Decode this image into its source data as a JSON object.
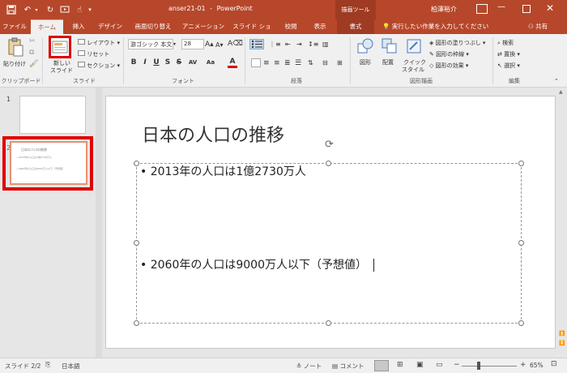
{
  "titlebar": {
    "file_name": "anser21-01",
    "separator": "-",
    "app_name": "PowerPoint",
    "context_tool": "描画ツール",
    "user_name": "柏澤裕介"
  },
  "tabs": [
    {
      "label": "ファイル"
    },
    {
      "label": "ホーム"
    },
    {
      "label": "挿入"
    },
    {
      "label": "デザイン"
    },
    {
      "label": "画面切り替え"
    },
    {
      "label": "アニメーション"
    },
    {
      "label": "スライド ショー"
    },
    {
      "label": "校閲"
    },
    {
      "label": "表示"
    },
    {
      "label": "書式"
    }
  ],
  "tell_me": "実行したい作業を入力してください",
  "share_label": "共有",
  "ribbon": {
    "clipboard": {
      "paste": "貼り付け",
      "group": "クリップボード"
    },
    "slides": {
      "new_slide_line1": "新しい",
      "new_slide_line2": "スライド",
      "layout": "レイアウト",
      "reset": "リセット",
      "section": "セクション",
      "group": "スライド"
    },
    "font": {
      "font_name": "游ゴシック 本文",
      "font_size": "28",
      "group": "フォント",
      "bold": "B",
      "italic": "I",
      "underline": "U",
      "strike": "S",
      "shadow": "S",
      "spacing": "AV",
      "caps": "Aa",
      "color": "A"
    },
    "paragraph": {
      "group": "段落"
    },
    "drawing": {
      "shapes": "図形",
      "arrange": "配置",
      "quick_style_line1": "クイック",
      "quick_style_line2": "スタイル",
      "fill": "図形の塗りつぶし",
      "outline": "図形の枠線",
      "effects": "図形の効果",
      "group": "図形描画"
    },
    "editing": {
      "find": "検索",
      "replace": "置換",
      "select": "選択",
      "group": "編集"
    }
  },
  "slides": [
    {
      "number": "1",
      "selected": false
    },
    {
      "number": "2",
      "selected": true,
      "thumb_title": "日本の人口の推移",
      "thumb_line1": "• 2013年の人口は1億2730万人",
      "thumb_line2": "• 2060年の人口は9000万人以下（予想値）"
    }
  ],
  "slide": {
    "title": "日本の人口の推移",
    "bullet1": "2013年の人口は1億2730万人",
    "bullet2": "2060年の人口は9000万人以下（予想値）",
    "bullet_char": "•"
  },
  "status": {
    "slide_info": "スライド 2/2",
    "language": "日本語",
    "notes": "ノート",
    "comments": "コメント",
    "zoom_minus": "−",
    "zoom_plus": "+",
    "zoom": "65%"
  },
  "colors": {
    "accent": "#b7472a",
    "highlight": "#e00000"
  }
}
